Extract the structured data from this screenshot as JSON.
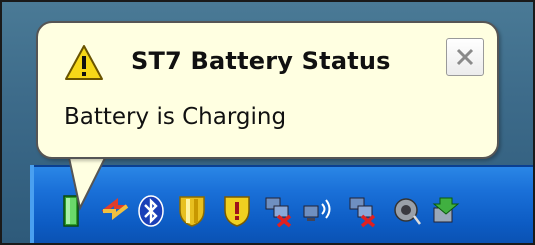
{
  "balloon": {
    "title": "ST7 Battery Status",
    "message": "Battery is Charging",
    "icon": "warning-icon",
    "close_icon": "close-icon"
  },
  "tray": {
    "icons": [
      {
        "name": "battery-icon",
        "color": "#3fb83f"
      },
      {
        "name": "network-arrows-icon",
        "color": "#e0402a"
      },
      {
        "name": "bluetooth-icon",
        "color": "#1a4fd0"
      },
      {
        "name": "shield-icon",
        "color": "#e8c020"
      },
      {
        "name": "security-alert-icon",
        "color": "#f0d020"
      },
      {
        "name": "network-disconnected-icon",
        "color": "#d02020"
      },
      {
        "name": "wireless-network-icon",
        "color": "#7090d0"
      },
      {
        "name": "network-disconnected-icon",
        "color": "#d02020"
      },
      {
        "name": "speaker-icon",
        "color": "#888888"
      },
      {
        "name": "safely-remove-hardware-icon",
        "color": "#40a040"
      }
    ]
  },
  "colors": {
    "balloon_bg": "#ffffe1",
    "taskbar": "#1a70d8",
    "desktop": "#3d6b8a"
  }
}
